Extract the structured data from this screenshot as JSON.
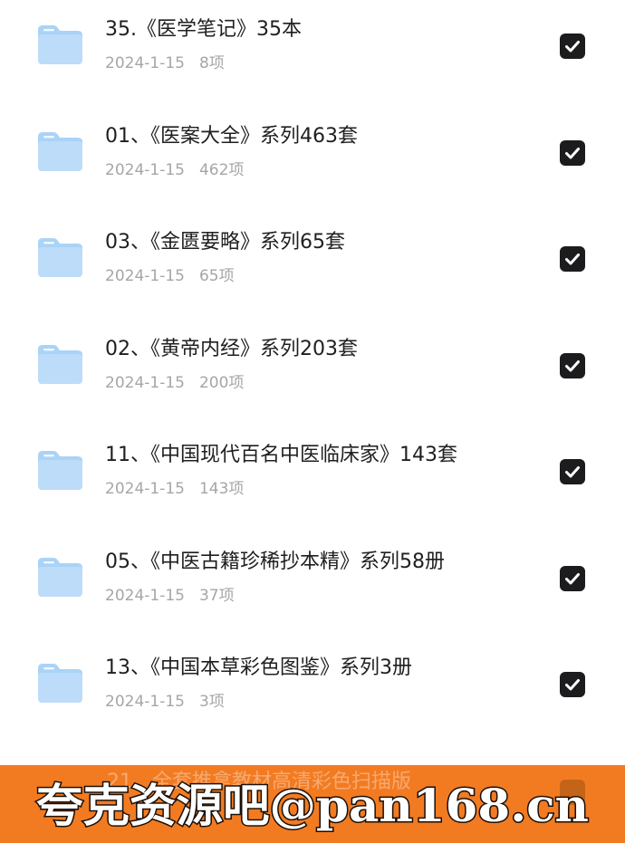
{
  "files": [
    {
      "title": "35.《医学笔记》35本",
      "date": "2024-1-15",
      "count": "8项",
      "checked": true
    },
    {
      "title": "01、《医案大全》系列463套",
      "date": "2024-1-15",
      "count": "462项",
      "checked": true
    },
    {
      "title": "03、《金匮要略》系列65套",
      "date": "2024-1-15",
      "count": "65项",
      "checked": true
    },
    {
      "title": "02、《黄帝内经》系列203套",
      "date": "2024-1-15",
      "count": "200项",
      "checked": true
    },
    {
      "title": "11、《中国现代百名中医临床家》143套",
      "date": "2024-1-15",
      "count": "143项",
      "checked": true
    },
    {
      "title": "05、《中医古籍珍稀抄本精》系列58册",
      "date": "2024-1-15",
      "count": "37项",
      "checked": true
    },
    {
      "title": "13、《中国本草彩色图鉴》系列3册",
      "date": "2024-1-15",
      "count": "3项",
      "checked": true
    }
  ],
  "partial_row": {
    "title": "21、全套推拿教材高清彩色扫描版"
  },
  "watermark": {
    "text": "夸克资源吧@pan168.cn"
  },
  "colors": {
    "folder": "#a9d3f7",
    "checkbox": "#1c1c1e",
    "banner": "#f27b22",
    "watermark_fill": "#ffffff",
    "watermark_stroke": "#1a1008",
    "title_text": "#1f1f1f",
    "meta_text": "#a6a6a6"
  }
}
